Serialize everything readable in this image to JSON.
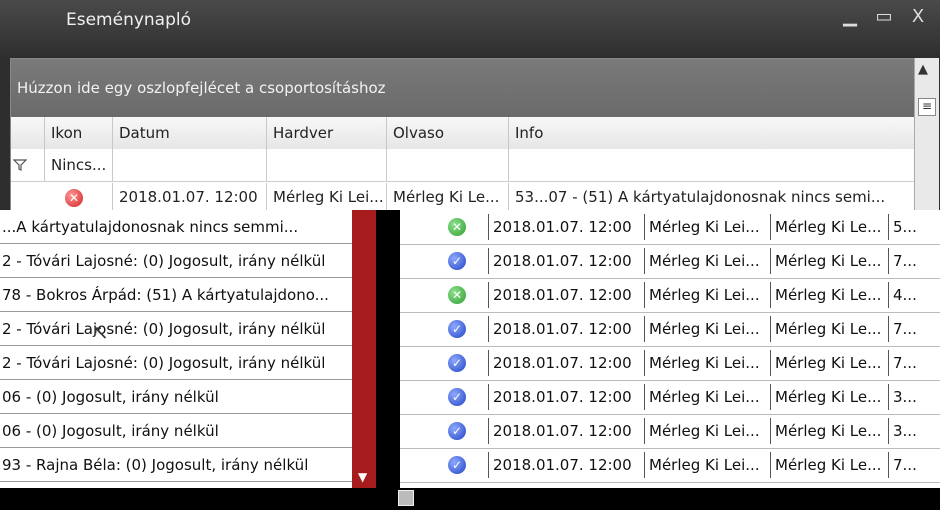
{
  "window": {
    "title": "Eseménynapló",
    "min_glyph": "▁",
    "max_glyph": "▭",
    "close_glyph": "X"
  },
  "grid": {
    "group_hint": "Húzzon ide egy oszlopfejlécet a csoportosításhoz",
    "columns": [
      "Ikon",
      "Datum",
      "Hardver",
      "Olvaso",
      "Info"
    ],
    "filter_value": "Nincs...",
    "filter_icon": "funnel-icon",
    "top_row": {
      "icon": "error-icon",
      "datum": "2018.01.07. 12:00",
      "hardver": "Mérleg Ki Lei...",
      "olvaso": "Mérleg Ki Le...",
      "info": "53...07 - (51) A kártyatulajdonosnak nincs semi..."
    }
  },
  "left_rows": [
    "...A kártyatulajdonosnak nincs semmi...",
    "2 - Tóvári Lajosné: (0) Jogosult, irány nélkül",
    "78 - Bokros Árpád: (51) A kártyatulajdono...",
    "2 - Tóvári Lajosné: (0) Jogosult, irány nélkül",
    "2 - Tóvári Lajosné: (0) Jogosult, irány nélkül",
    "06 - (0) Jogosult, irány nélkül",
    "06 - (0) Jogosult, irány nélkül",
    "93 - Rajna Béla: (0) Jogosult, irány nélkül"
  ],
  "right_rows": [
    {
      "icon": "ok",
      "datum": "2018.01.07. 12:00",
      "hardver": "Mérleg Ki Lei...",
      "olvaso": "Mérleg Ki Le...",
      "info": "5..."
    },
    {
      "icon": "check",
      "datum": "2018.01.07. 12:00",
      "hardver": "Mérleg Ki Lei...",
      "olvaso": "Mérleg Ki Le...",
      "info": "7..."
    },
    {
      "icon": "ok",
      "datum": "2018.01.07. 12:00",
      "hardver": "Mérleg Ki Lei...",
      "olvaso": "Mérleg Ki Le...",
      "info": "4..."
    },
    {
      "icon": "check",
      "datum": "2018.01.07. 12:00",
      "hardver": "Mérleg Ki Lei...",
      "olvaso": "Mérleg Ki Le...",
      "info": "7..."
    },
    {
      "icon": "check",
      "datum": "2018.01.07. 12:00",
      "hardver": "Mérleg Ki Lei...",
      "olvaso": "Mérleg Ki Le...",
      "info": "7..."
    },
    {
      "icon": "check",
      "datum": "2018.01.07. 12:00",
      "hardver": "Mérleg Ki Lei...",
      "olvaso": "Mérleg Ki Le...",
      "info": "3..."
    },
    {
      "icon": "check",
      "datum": "2018.01.07. 12:00",
      "hardver": "Mérleg Ki Lei...",
      "olvaso": "Mérleg Ki Le...",
      "info": "3..."
    },
    {
      "icon": "check",
      "datum": "2018.01.07. 12:00",
      "hardver": "Mérleg Ki Lei...",
      "olvaso": "Mérleg Ki Le...",
      "info": "7..."
    }
  ],
  "colors": {
    "ok": "#2e9d2e",
    "check": "#1f43c2",
    "error": "#d42020",
    "scroll_accent": "#a61b1b"
  }
}
